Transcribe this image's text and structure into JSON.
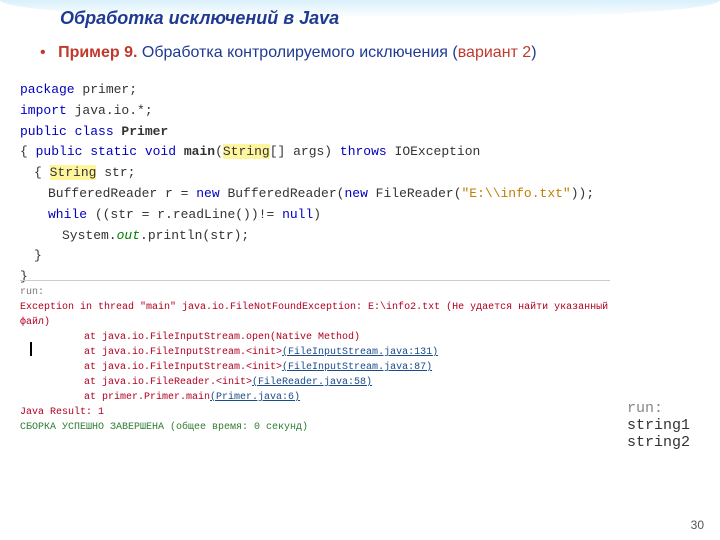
{
  "title": "Обработка исключений в Java",
  "subtitle": {
    "example": "Пример 9.",
    "text": "Обработка контролируемого исключения (",
    "variant": "вариант 2",
    "close": ")"
  },
  "code": {
    "l1a": "package",
    "l1b": " primer;",
    "l2a": "import",
    "l2b": " java.io.*;",
    "l3a": "public class ",
    "l3b": "Primer",
    "l4a": "{ ",
    "l4b": "public static void ",
    "l4c": "main",
    "l4d": "(",
    "l4e": "String",
    "l4f": "[] args) ",
    "l4g": "throws",
    "l4h": " IOException",
    "l5a": "{ ",
    "l5b": "String",
    "l5c": " str;",
    "l6a": "BufferedReader r = ",
    "l6b": "new",
    "l6c": " BufferedReader(",
    "l6d": "new",
    "l6e": " FileReader(",
    "l6f": "\"E:\\\\info.txt\"",
    "l6g": "));",
    "l7a": "while",
    "l7b": " ((str = r.readLine())!= ",
    "l7c": "null",
    "l7d": ")",
    "l8a": "System.",
    "l8b": "out",
    "l8c": ".println(str);",
    "l9": "}",
    "l10": "}"
  },
  "console": {
    "run": "run:",
    "l1": "Exception in thread \"main\" java.io.FileNotFoundException: E:\\info2.txt (Не удается найти указанный файл)",
    "l2a": "at java.io.FileInputStream.open(Native Method)",
    "l3a": "at java.io.FileInputStream.<init>",
    "l3b": "(FileInputStream.java:131)",
    "l4a": "at java.io.FileInputStream.<init>",
    "l4b": "(FileInputStream.java:87)",
    "l5a": "at java.io.FileReader.<init>",
    "l5b": "(FileReader.java:58)",
    "l6a": "at primer.Primer.main",
    "l6b": "(Primer.java:6)",
    "result": "Java Result: 1",
    "build": "СБОРКА УСПЕШНО ЗАВЕРШЕНА (общее время: 0 секунд)"
  },
  "output": {
    "run": "run:",
    "s1": "string1",
    "s2": "string2"
  },
  "page": "30"
}
